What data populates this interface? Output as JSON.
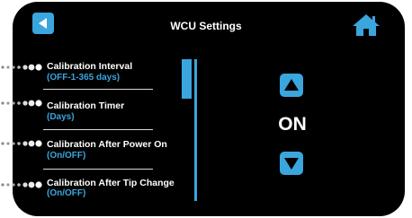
{
  "header": {
    "title": "WCU Settings",
    "back_icon": "back-arrow-icon",
    "home_icon": "home-icon"
  },
  "menu": {
    "items": [
      {
        "label": "Calibration Interval",
        "sub": "(OFF-1-365 days)"
      },
      {
        "label": "Calibration Timer",
        "sub": "(Days)"
      },
      {
        "label": "Calibration After Power On",
        "sub": "(On/OFF)"
      },
      {
        "label": "Calibration After Tip Change",
        "sub": "(On/OFF)"
      }
    ]
  },
  "control": {
    "value": "ON",
    "up_icon": "triangle-up-icon",
    "down_icon": "triangle-down-icon"
  },
  "colors": {
    "accent": "#3aa6dd",
    "background": "#000000",
    "text": "#ffffff"
  }
}
